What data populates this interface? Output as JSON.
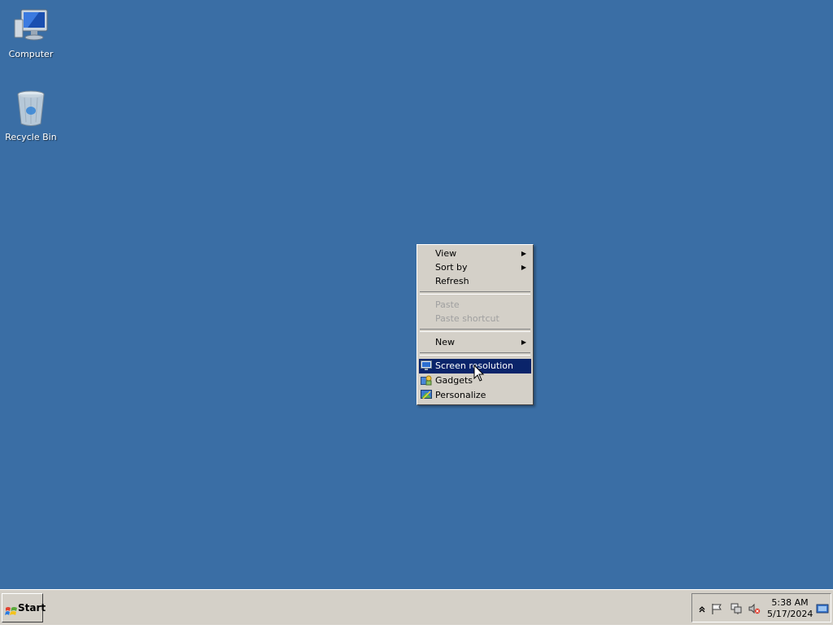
{
  "desktop": {
    "background": "#3a6ea5",
    "icons": [
      {
        "label": "Computer",
        "icon": "computer-icon"
      },
      {
        "label": "Recycle Bin",
        "icon": "recycle-bin-icon"
      }
    ]
  },
  "context_menu": {
    "items": [
      {
        "label": "View",
        "submenu": true,
        "disabled": false
      },
      {
        "label": "Sort by",
        "submenu": true,
        "disabled": false
      },
      {
        "label": "Refresh",
        "submenu": false,
        "disabled": false
      },
      {
        "label": "Paste",
        "submenu": false,
        "disabled": true
      },
      {
        "label": "Paste shortcut",
        "submenu": false,
        "disabled": true
      },
      {
        "label": "New",
        "submenu": true,
        "disabled": false
      },
      {
        "label": "Screen resolution",
        "icon": "screen-resolution-icon",
        "highlighted": true
      },
      {
        "label": "Gadgets",
        "icon": "gadgets-icon",
        "highlighted": false
      },
      {
        "label": "Personalize",
        "icon": "personalize-icon",
        "highlighted": false
      }
    ],
    "highlight_color": "#0a246a"
  },
  "taskbar": {
    "start_label": "Start",
    "clock": {
      "time": "5:38 AM",
      "date": "5/17/2024"
    },
    "tray_icons": [
      "show-hidden-icons-icon",
      "action-center-flag-icon",
      "network-icon",
      "volume-muted-icon",
      "show-desktop-icon"
    ]
  }
}
